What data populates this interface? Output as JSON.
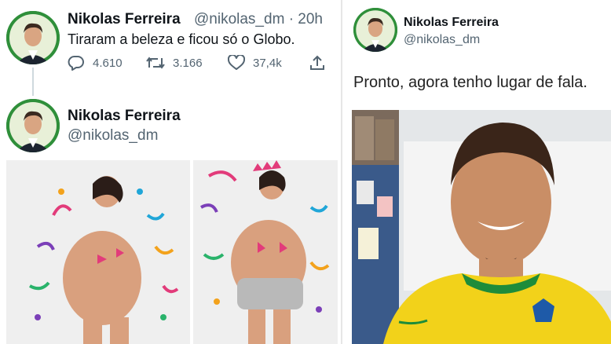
{
  "tweet1": {
    "display_name": "Nikolas Ferreira",
    "handle": "@nikolas_dm",
    "separator": "·",
    "time": "20h",
    "text": "Tiraram a beleza e ficou só o Globo.",
    "actions": {
      "replies": "4.610",
      "retweets": "3.166",
      "likes": "37,4k"
    }
  },
  "tweet2": {
    "display_name": "Nikolas Ferreira",
    "handle": "@nikolas_dm"
  },
  "tweet3": {
    "display_name": "Nikolas Ferreira",
    "handle": "@nikolas_dm",
    "text": "Pronto, agora tenho lugar de fala."
  },
  "colors": {
    "avatar_bg": "#2f8f3a",
    "muted_text": "#536471",
    "jersey_yellow": "#f2d21a",
    "jersey_green": "#1e8c3a"
  }
}
